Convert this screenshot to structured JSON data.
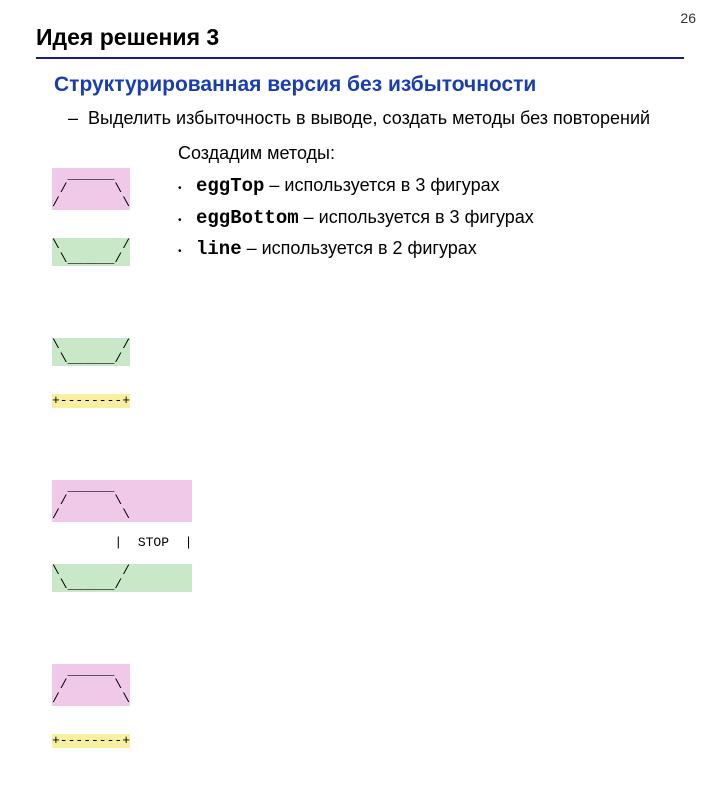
{
  "page_number": "26",
  "title": "Идея решения 3",
  "subtitle": "Структурированная версия без избыточности",
  "dash_item": "Выделить избыточность в выводе, создать методы без повторений",
  "methods_intro": "Создадим методы:",
  "methods": [
    {
      "name": "eggTop",
      "desc": " – используется в 3 фигурах"
    },
    {
      "name": "eggBottom",
      "desc": " – используется в 3 фигурах"
    },
    {
      "name": "line",
      "desc": " – используется в 2 фигурах"
    }
  ],
  "figures": {
    "egg": {
      "pink": "  ______  \n /      \\ \n/        \\",
      "green": "\\        /\n \\______/ "
    },
    "teacup": {
      "green": "\\        /\n \\______/ ",
      "yellow": "+--------+"
    },
    "stop": {
      "pink": "  ______  \n /      \\ \n/        \\",
      "white": "|  STOP  |",
      "green": "\\        /\n \\______/ "
    },
    "hat": {
      "pink": "  ______  \n /      \\ \n/        \\",
      "yellow": "+--------+"
    }
  }
}
